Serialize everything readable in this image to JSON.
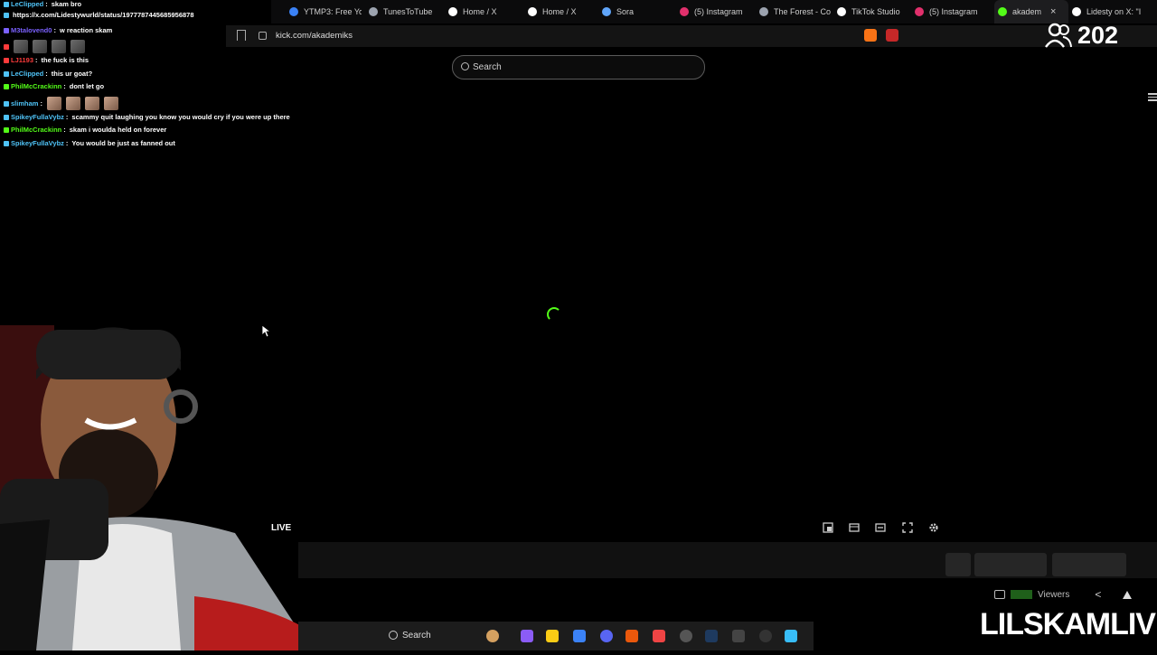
{
  "browser": {
    "tabs": [
      {
        "label": "YTMP3: Free Yo",
        "icon": "ytmp3-icon",
        "color": "#3b82f6"
      },
      {
        "label": "TunesToTube",
        "icon": "tunestotube-icon",
        "color": "#9ca3af"
      },
      {
        "label": "Home / X",
        "icon": "x-icon",
        "color": "#ffffff"
      },
      {
        "label": "Home / X",
        "icon": "x-icon",
        "color": "#ffffff"
      },
      {
        "label": "Sora",
        "icon": "sora-icon",
        "color": "#60a5fa"
      },
      {
        "label": "(5) Instagram",
        "icon": "instagram-icon",
        "color": "#e1306c"
      },
      {
        "label": "The Forest - Co",
        "icon": "forest-icon",
        "color": "#9ca3af"
      },
      {
        "label": "TikTok Studio",
        "icon": "tiktok-icon",
        "color": "#ffffff"
      },
      {
        "label": "(5) Instagram",
        "icon": "instagram-icon",
        "color": "#e1306c"
      },
      {
        "label": "akadem",
        "icon": "kick-icon",
        "color": "#53fc18",
        "active": true
      },
      {
        "label": "Lidesty on X: \"I",
        "icon": "x-icon",
        "color": "#ffffff"
      }
    ],
    "url": "kick.com/akademiks"
  },
  "search": {
    "placeholder": "Search"
  },
  "viewer_count": "202",
  "chat": [
    {
      "user": "LeClipped",
      "user_color": "#4fc3f7",
      "text": "skam bro"
    },
    {
      "user": "",
      "user_color": "#4fc3f7",
      "text": "https://x.com/Lidestywurld/status/1977787445685956878"
    },
    {
      "user": "M3talovend0",
      "user_color": "#7b61ff",
      "text": "w reaction skam"
    },
    {
      "user": "",
      "user_color": "#ff3b3b",
      "text": "",
      "emotes": 4
    },
    {
      "user": "LJ1193",
      "user_color": "#ff3b3b",
      "text": "the fuck is this"
    },
    {
      "user": "LeClipped",
      "user_color": "#4fc3f7",
      "text": "this ur goat?"
    },
    {
      "user": "PhilMcCrackinn",
      "user_color": "#53fc18",
      "text": "dont let go"
    },
    {
      "user": "slimham",
      "user_color": "#4fc3f7",
      "text": "",
      "emotes": 4
    },
    {
      "user": "SpikeyFullaVybz",
      "user_color": "#4fc3f7",
      "text": "scammy quit laughing you know you would cry if you were up there"
    },
    {
      "user": "PhilMcCrackinn",
      "user_color": "#53fc18",
      "text": "skam i woulda held on forever"
    },
    {
      "user": "SpikeyFullaVybz",
      "user_color": "#4fc3f7",
      "text": "You would be just as fanned out"
    }
  ],
  "player": {
    "live_label": "LIVE"
  },
  "stats": {
    "viewers_label": "Viewers"
  },
  "taskbar": {
    "search_label": "Search"
  },
  "watermark": "LILSKAMLIVE",
  "colors": {
    "kick_green": "#53fc18",
    "background": "#000000"
  }
}
